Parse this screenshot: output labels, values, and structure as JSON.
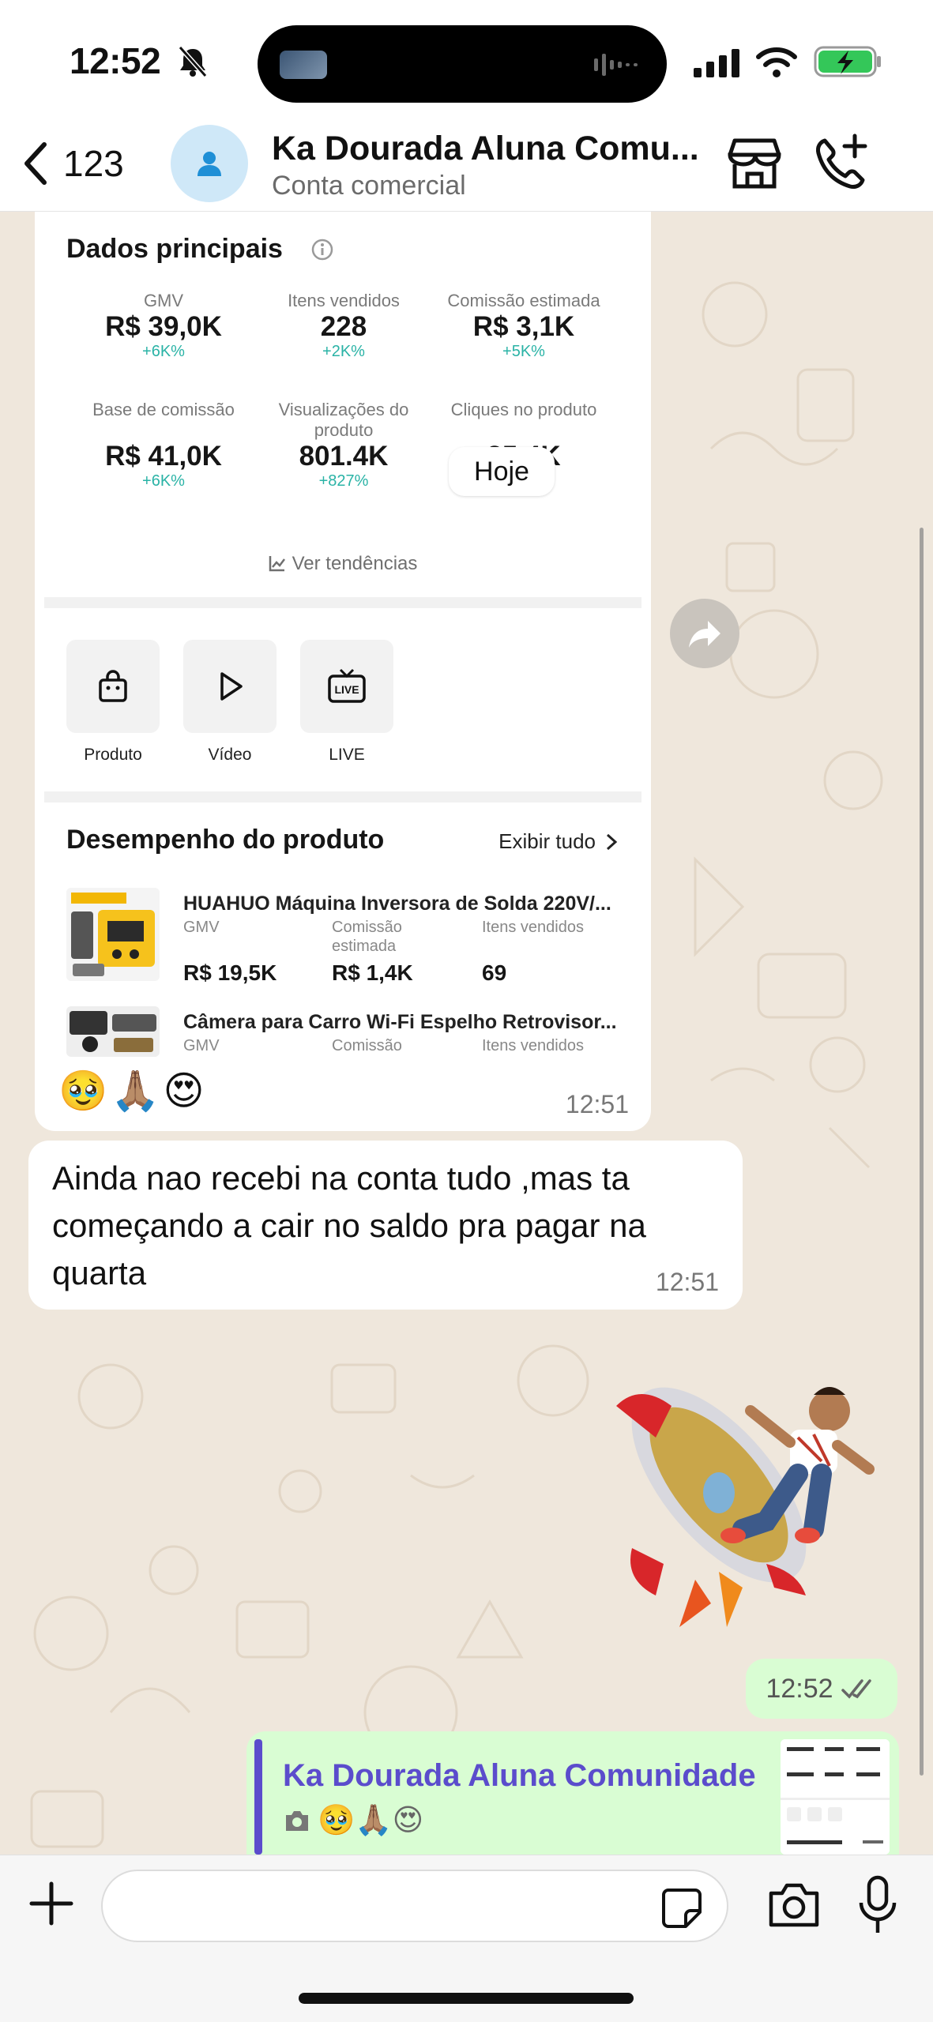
{
  "status_bar": {
    "time": "12:52"
  },
  "header": {
    "back_count": "123",
    "title": "Ka Dourada Aluna Comu...",
    "subtitle": "Conta comercial"
  },
  "forwarded_screenshot": {
    "date_pill": "Hoje",
    "section_title": "Dados principais",
    "metrics": [
      {
        "label": "GMV",
        "value": "R$ 39,0K",
        "change": "+6K%"
      },
      {
        "label": "Itens vendidos",
        "value": "228",
        "change": "+2K%"
      },
      {
        "label": "Comissão estimada",
        "value": "R$ 3,1K",
        "change": "+5K%"
      },
      {
        "label": "Base de comissão",
        "value": "R$ 41,0K",
        "change": "+6K%"
      },
      {
        "label": "Visualizações do produto",
        "value": "801.4K",
        "change": "+827%"
      },
      {
        "label": "Cliques no produto",
        "value": "25.4K",
        "change": "+1K%"
      }
    ],
    "trend_link": "Ver tendências",
    "quick_actions": [
      "Produto",
      "Vídeo",
      "LIVE"
    ],
    "performance_title": "Desempenho do produto",
    "performance_all": "Exibir tudo",
    "products": [
      {
        "name": "HUAHUO Máquina Inversora de Solda 220V/...",
        "col_labels": [
          "GMV",
          "Comissão estimada",
          "Itens vendidos"
        ],
        "col_values": [
          "R$ 19,5K",
          "R$ 1,4K",
          "69"
        ]
      },
      {
        "name": "Câmera para Carro Wi-Fi Espelho Retrovisor...",
        "col_labels": [
          "GMV",
          "Comissão",
          "Itens vendidos"
        ]
      }
    ],
    "reactions": "🥹🙏🏽😍",
    "time": "12:51"
  },
  "incoming_message": {
    "text": "Ainda nao recebi na conta tudo ,mas ta começando a cair no saldo pra pagar na quarta",
    "time": "12:51"
  },
  "outgoing_time": "12:52",
  "reply_preview": {
    "name": "Ka Dourada Aluna Comunidade",
    "emojis": "🥹🙏🏽😍"
  },
  "input_bar": {
    "placeholder": ""
  },
  "icons": {
    "back": "chevron-left-icon",
    "avatar": "person-icon",
    "store": "store-icon",
    "call_add": "phone-plus-icon",
    "forward": "forward-arrow-icon",
    "plus": "plus-icon",
    "sticker": "sticker-icon",
    "camera": "camera-icon",
    "mic": "microphone-icon"
  },
  "colors": {
    "chat_bg": "#efe7dc",
    "outgoing_bubble": "#d9fdd3",
    "incoming_bubble": "#ffffff",
    "reply_accent": "#5b4ccc",
    "metric_change": "#2ab3a6",
    "avatar_bg": "#cfe8f8"
  }
}
